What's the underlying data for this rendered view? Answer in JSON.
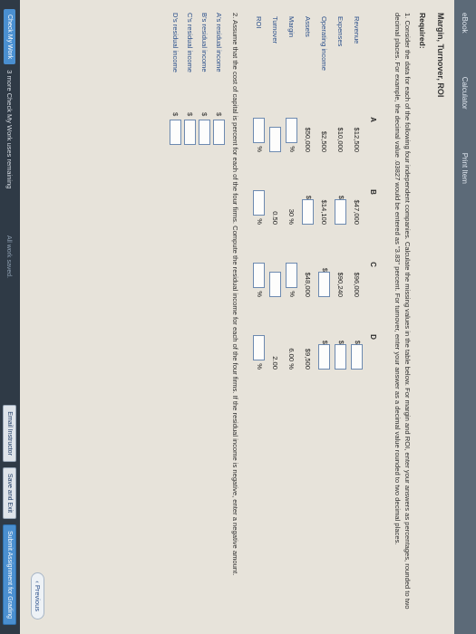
{
  "topbar": {
    "ebook": "eBook",
    "calculator": "Calculator",
    "print": "Print Item"
  },
  "page": {
    "title": "Margin, Turnover, ROI",
    "required": "Required:",
    "q1": "1. Consider the data for each of the following four independent companies. Calculate the missing values in the table below. For margin and ROI, enter your answers as percentages, rounded to two decimal places. For example, the decimal value .03827 would be entered as \"3.83\" percent. For turnover, enter your answer as a decimal value rounded to two decimal places.",
    "q2": "2. Assume that the cost of capital is percent for each of the four firms. Compute the residual income for each of the four firms. If the residual income is negative, enter a negative amount."
  },
  "table": {
    "headers": [
      "A",
      "B",
      "C",
      "D"
    ],
    "rows": [
      {
        "label": "Revenue",
        "cells": [
          "$12,500",
          "$47,000",
          "$96,000",
          "input"
        ]
      },
      {
        "label": "Expenses",
        "cells": [
          "$10,000",
          "input",
          "$90,240",
          "input"
        ]
      },
      {
        "label": "Operating income",
        "cells": [
          "$2,500",
          "$14,100",
          "input",
          "input"
        ]
      },
      {
        "label": "Assets",
        "cells": [
          "$50,000",
          "input",
          "$48,000",
          "$9,500"
        ]
      },
      {
        "label": "Margin",
        "cells": [
          "input%",
          "30 %",
          "input%",
          "6.00 %"
        ]
      },
      {
        "label": "Turnover",
        "cells": [
          "input",
          "0.50",
          "input",
          "2.00"
        ]
      },
      {
        "label": "ROI",
        "cells": [
          "input%",
          "input%",
          "input%",
          "input%"
        ]
      }
    ]
  },
  "residual": [
    {
      "label": "A's residual income"
    },
    {
      "label": "B's residual income"
    },
    {
      "label": "C's residual income"
    },
    {
      "label": "D's residual income"
    }
  ],
  "footer": {
    "check": "Check My Work",
    "remaining": "3 more Check My Work uses remaining",
    "previous": "Previous",
    "saved": "All work saved.",
    "email": "Email Instructor",
    "save_exit": "Save and Exit",
    "submit": "Submit Assignment for Grading"
  }
}
